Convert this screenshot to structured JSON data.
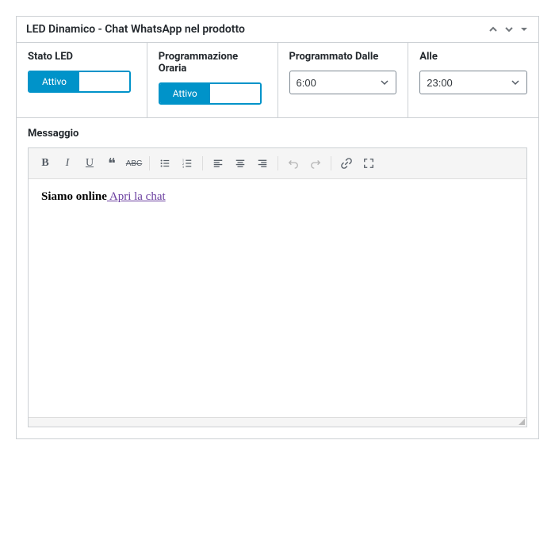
{
  "panel": {
    "title": "LED Dinamico - Chat WhatsApp nel prodotto"
  },
  "fields": {
    "status": {
      "label": "Stato LED",
      "toggle": "Attivo"
    },
    "schedule": {
      "label": "Programmazione Oraria",
      "toggle": "Attivo"
    },
    "from": {
      "label": "Programmato Dalle",
      "value": "6:00"
    },
    "to": {
      "label": "Alle",
      "value": "23:00"
    }
  },
  "message": {
    "label": "Messaggio",
    "bold_text": "Siamo online",
    "link_text": " Apri la chat"
  }
}
